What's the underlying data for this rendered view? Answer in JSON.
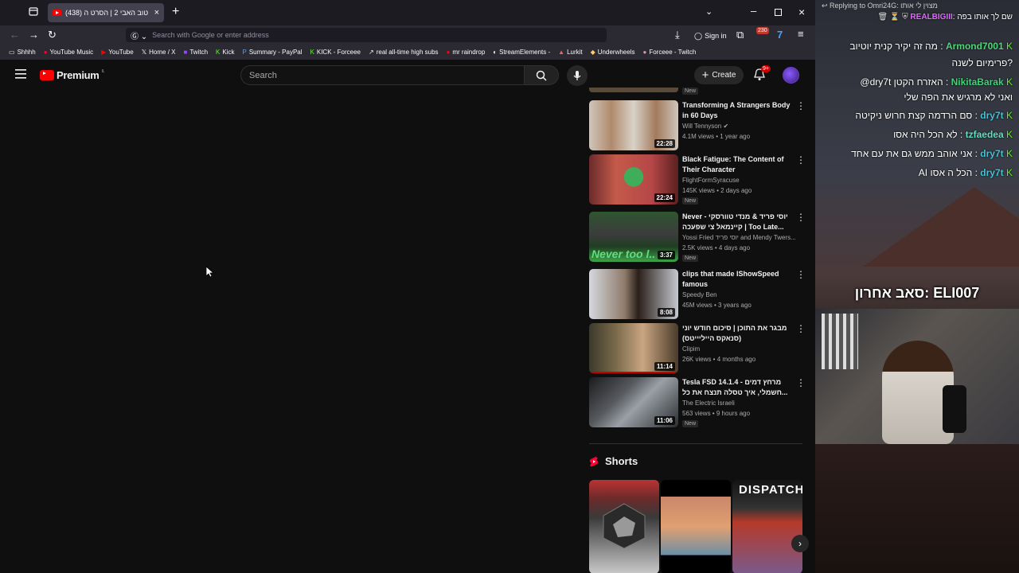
{
  "browser": {
    "tab_title": "שם טוב האבי 2 | הסרט ה (438)",
    "url_placeholder": "Search with Google or enter address",
    "sign_in": "Sign in",
    "ext_badge": "230",
    "bookmarks": [
      "Shhhh",
      "YouTube Music",
      "YouTube",
      "Home / X",
      "Twitch",
      "Kick",
      "Summary - PayPal",
      "KICK - Forceee",
      "real all-time high subs",
      "mr raindrop",
      "StreamElements -",
      "Lurkit",
      "Underwheels",
      "Forceee - Twitch"
    ]
  },
  "youtube": {
    "logo_text": "Premium",
    "logo_sup": "IL",
    "search_placeholder": "Search",
    "create_label": "Create",
    "notif_count": "9+",
    "videos": [
      {
        "title": "Transforming A Strangers Body in 60 Days",
        "channel": "Will Tennyson",
        "meta": "4.1M views • 1 year ago",
        "duration": "22:28",
        "new": ""
      },
      {
        "title": "Black Fatigue: The Content of Their Character",
        "channel": "FlightFormSyracuse",
        "meta": "145K views • 2 days ago",
        "duration": "22:24",
        "new": "New"
      },
      {
        "title": "Never - יוסי פריד & מנדי טוורסקי קיינמאל צי שפעכה | Too Late...",
        "channel": "Yossi Fried יוסי פריד  and Mendy Twers...",
        "meta": "2.5K views • 4 days ago",
        "duration": "3:37",
        "new": "New"
      },
      {
        "title": "clips that made IShowSpeed famous",
        "channel": "Speedy Ben",
        "meta": "45M views • 3 years ago",
        "duration": "8:08",
        "new": ""
      },
      {
        "title": "מבגר את התוכן | סיכום חודש יוני (סנאקס הייליייטס)",
        "channel": "Clipim",
        "meta": "26K views • 4 months ago",
        "duration": "11:14",
        "new": ""
      },
      {
        "title": "Tesla FSD 14.1.4 - מרחץ דמים חשמלי, איך טסלה תנצח את כל...",
        "channel": "The Electric Israeli",
        "meta": "563 views • 9 hours ago",
        "duration": "11:06",
        "new": "New"
      }
    ],
    "top_partial_new": "New",
    "shorts_title": "Shorts"
  },
  "stream": {
    "reply_line": "Replying to Omri24G: מצוין לי אותו",
    "top_line_user": "REALBIGIII",
    "top_line_msg": "שם לך אותו בפה",
    "chat": [
      {
        "user": "Armond7001",
        "msg": "מה זה יקיר קנית יוטיוב",
        "cont": "פרימיום לשנה?"
      },
      {
        "user": "NikitaBarak",
        "msg": "@dry7t האזרח הקטן",
        "cont": "ואני לא מרגיש את הפה שלי"
      },
      {
        "user": "dry7t",
        "msg": "סם הרדמה קצת חרוש ניקיטה",
        "cont": ""
      },
      {
        "user": "tzfaedea",
        "msg": "לא הכל היה אסו",
        "cont": ""
      },
      {
        "user": "dry7t",
        "msg": "אני אוהב ממש גם את עם אחד",
        "cont": ""
      },
      {
        "user": "dry7t",
        "msg": "AI הכל ה אסו",
        "cont": ""
      }
    ],
    "last_sub": "סאב אחרון: ELI007",
    "colors": {
      "armond": "#4fd67a",
      "nikita": "#3fd27a",
      "dry7t": "#46c2d6",
      "tzfaedea": "#5fe0c0"
    }
  }
}
